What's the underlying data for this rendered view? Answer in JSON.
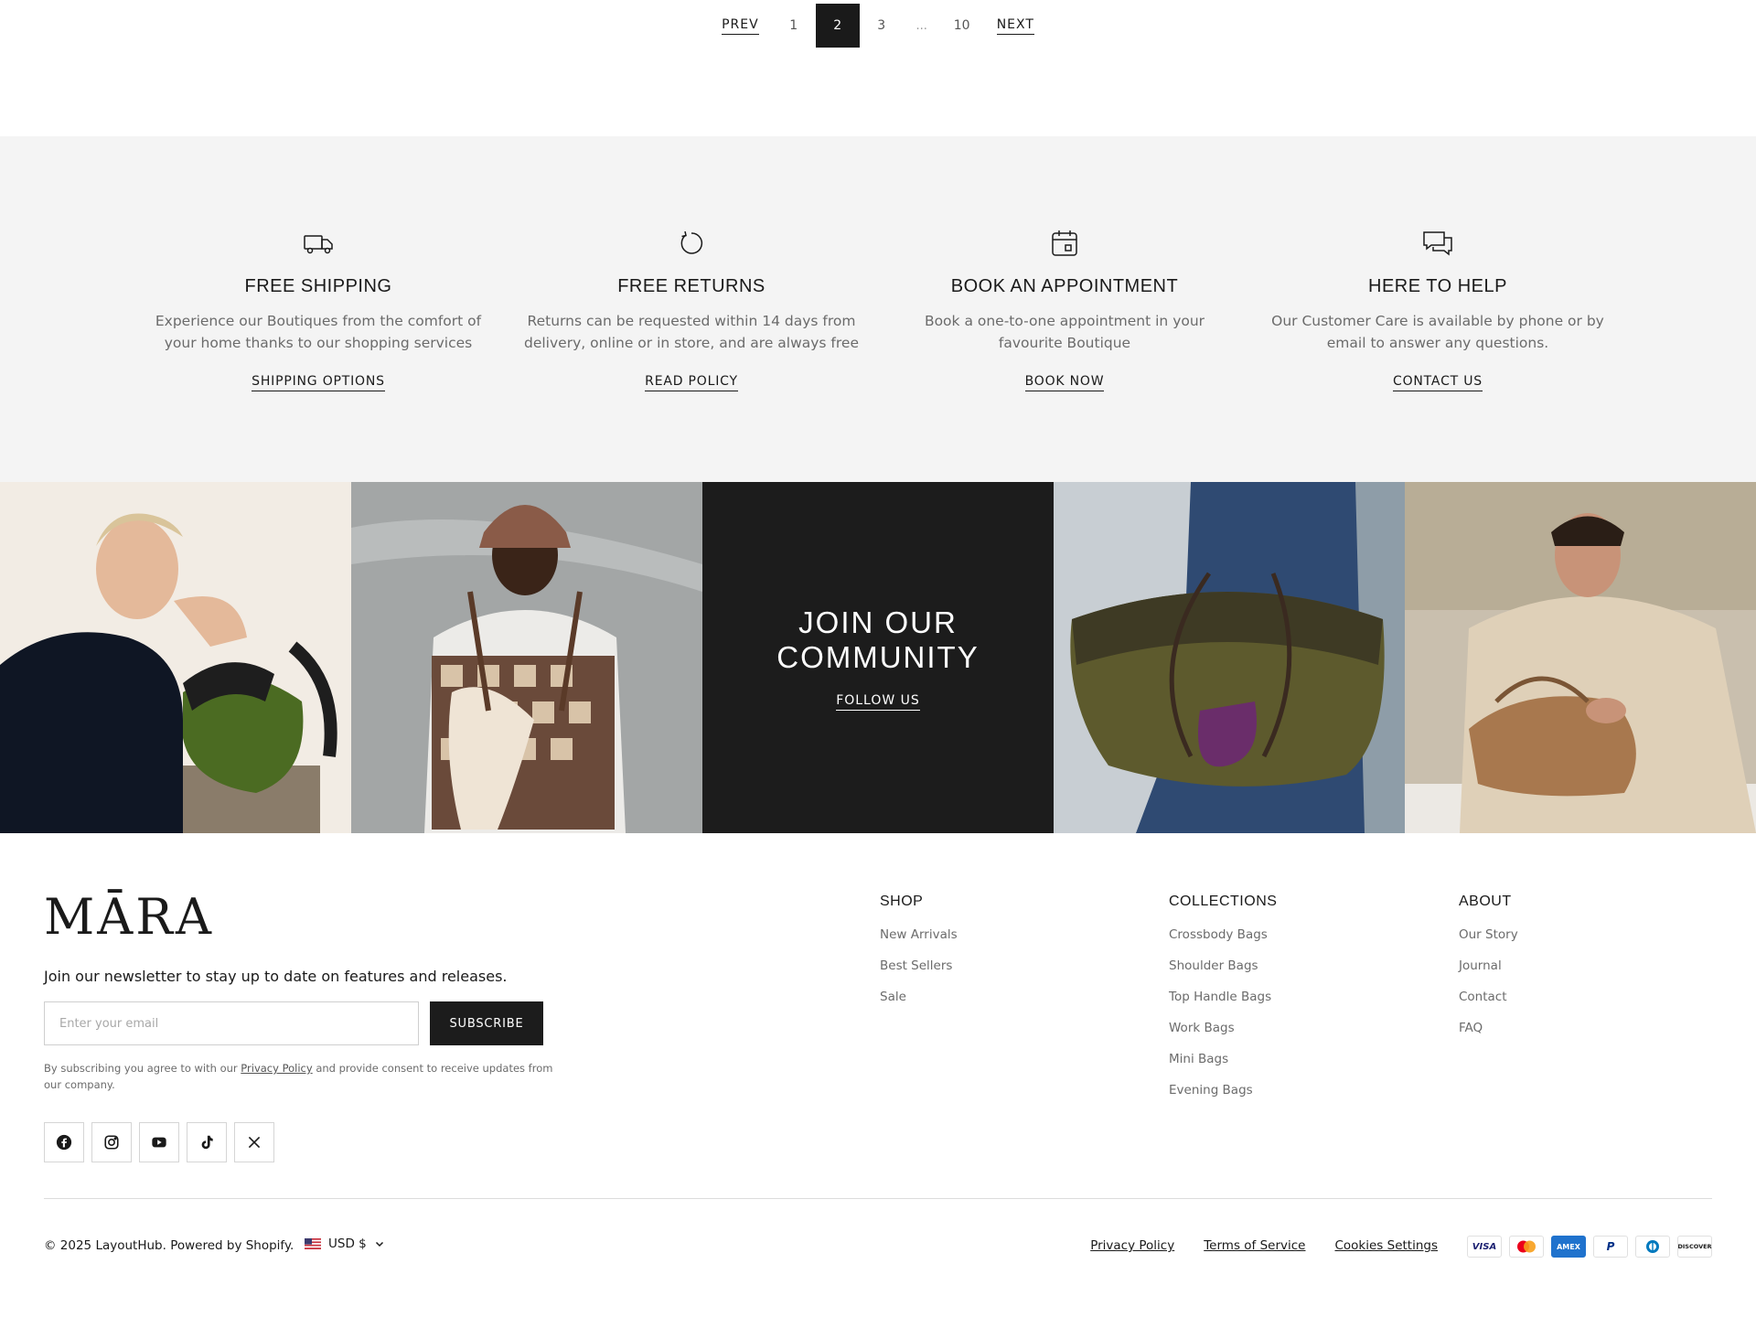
{
  "pagination": {
    "prev": "PREV",
    "pages": [
      "1",
      "2",
      "3",
      "10"
    ],
    "active": "2",
    "ellipsis": "...",
    "next": "NEXT"
  },
  "services": [
    {
      "title": "FREE SHIPPING",
      "text": "Experience our Boutiques from the comfort of your home thanks to our shopping services",
      "cta": "SHIPPING OPTIONS",
      "icon": "truck-icon"
    },
    {
      "title": "FREE RETURNS",
      "text": "Returns can be requested within 14 days from delivery, online or in store, and are always free",
      "cta": "READ POLICY",
      "icon": "return-arrow-icon"
    },
    {
      "title": "BOOK AN APPOINTMENT",
      "text": "Book a one-to-one appointment in your favourite Boutique",
      "cta": "BOOK NOW",
      "icon": "calendar-icon"
    },
    {
      "title": "HERE TO HELP",
      "text": "Our Customer Care is available by phone or by email to answer any questions.",
      "cta": "CONTACT US",
      "icon": "chat-bubbles-icon"
    }
  ],
  "community": {
    "title": "JOIN OUR COMMUNITY",
    "follow": "FOLLOW US"
  },
  "footer": {
    "logo": "MĀRA",
    "newsletter_text": "Join our newsletter to stay up to date on features and releases.",
    "email_placeholder": "Enter your email",
    "subscribe": "SUBSCRIBE",
    "consent_before": "By subscribing you agree to with our ",
    "consent_link": "Privacy Policy",
    "consent_after": " and provide consent to receive updates from our company.",
    "socials": [
      "facebook-icon",
      "instagram-icon",
      "youtube-icon",
      "tiktok-icon",
      "x-icon"
    ],
    "columns": [
      {
        "title": "SHOP",
        "links": [
          "New Arrivals",
          "Best Sellers",
          "Sale"
        ]
      },
      {
        "title": "COLLECTIONS",
        "links": [
          "Crossbody Bags",
          "Shoulder Bags",
          "Top Handle Bags",
          "Work Bags",
          "Mini Bags",
          "Evening Bags"
        ]
      },
      {
        "title": "ABOUT",
        "links": [
          "Our Story",
          "Journal",
          "Contact",
          "FAQ"
        ]
      }
    ],
    "copyright": "© 2025 LayoutHub. Powered by Shopify.",
    "currency": "USD $",
    "legal": [
      "Privacy Policy",
      "Terms of Service",
      "Cookies Settings"
    ],
    "payments": [
      "VISA",
      "Mastercard",
      "AMEX",
      "PayPal",
      "Diners",
      "DISCOVER"
    ]
  },
  "colors": {
    "text": "#1a1a1a",
    "muted": "#6b6b6b",
    "service_bg": "#f4f4f4",
    "dark": "#1c1c1c"
  }
}
